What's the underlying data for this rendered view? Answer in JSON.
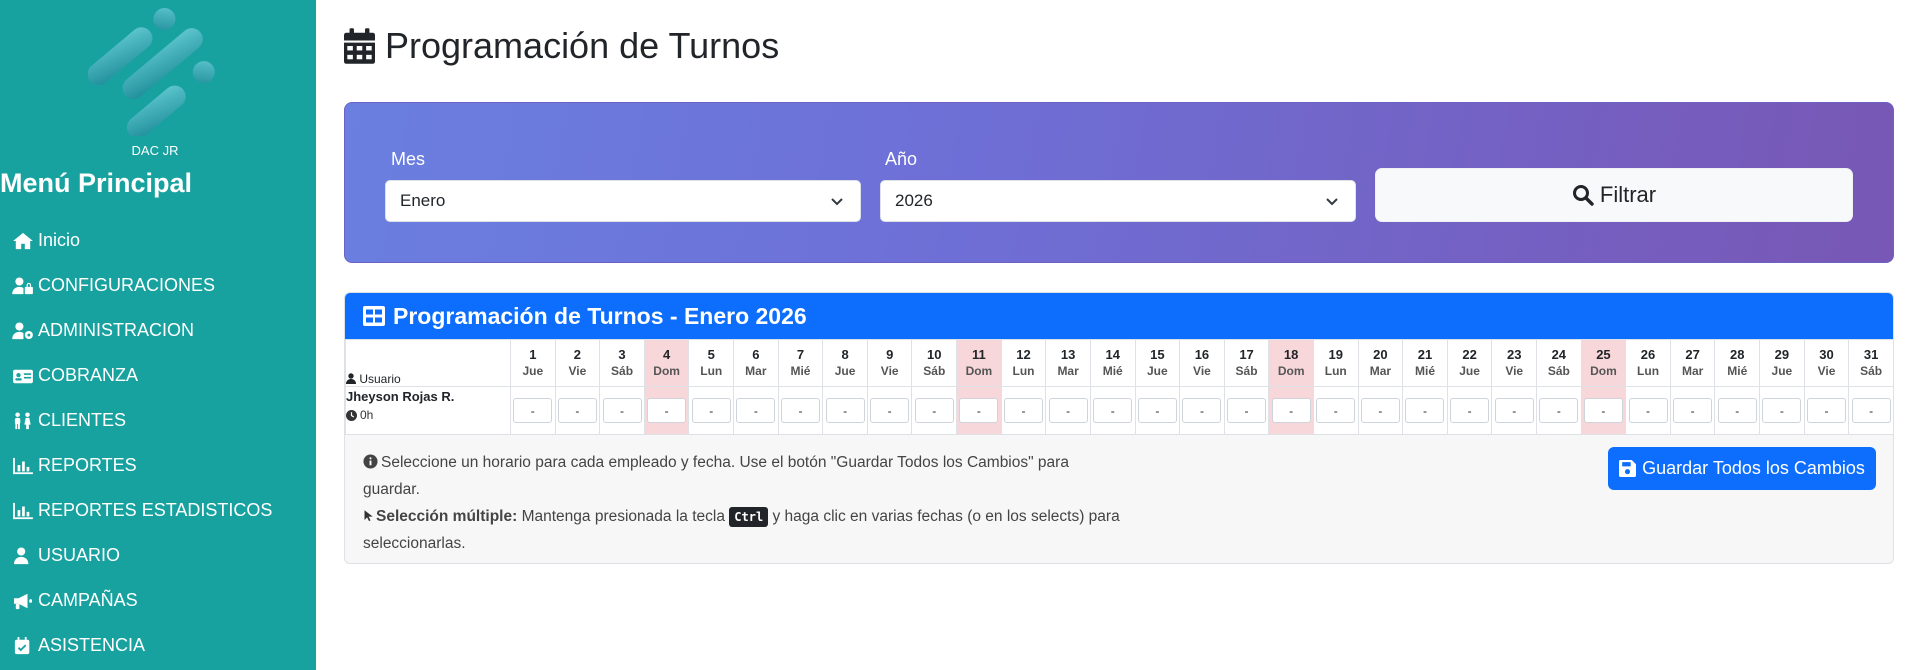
{
  "sidebar": {
    "brand": "DAC JR",
    "menu_title": "Menú Principal",
    "items": [
      {
        "label": "Inicio",
        "icon": "home-icon"
      },
      {
        "label": "CONFIGURACIONES",
        "icon": "user-lock-icon"
      },
      {
        "label": "ADMINISTRACION",
        "icon": "user-gear-icon"
      },
      {
        "label": "COBRANZA",
        "icon": "id-card-icon"
      },
      {
        "label": "CLIENTES",
        "icon": "people-icon"
      },
      {
        "label": "REPORTES",
        "icon": "chart-icon"
      },
      {
        "label": "REPORTES ESTADISTICOS",
        "icon": "chart-icon"
      },
      {
        "label": "USUARIO",
        "icon": "user-icon"
      },
      {
        "label": "CAMPAÑAS",
        "icon": "megaphone-icon"
      },
      {
        "label": "ASISTENCIA",
        "icon": "calendar-check-icon"
      }
    ]
  },
  "page": {
    "title": "Programación de Turnos"
  },
  "filter": {
    "month_label": "Mes",
    "month_value": "Enero",
    "year_label": "Año",
    "year_value": "2026",
    "button_label": "Filtrar"
  },
  "schedule": {
    "title": "Programación de Turnos - Enero 2026",
    "user_header": "Usuario",
    "days": [
      {
        "num": "1",
        "dow": "Jue"
      },
      {
        "num": "2",
        "dow": "Vie"
      },
      {
        "num": "3",
        "dow": "Sáb"
      },
      {
        "num": "4",
        "dow": "Dom"
      },
      {
        "num": "5",
        "dow": "Lun"
      },
      {
        "num": "6",
        "dow": "Mar"
      },
      {
        "num": "7",
        "dow": "Mié"
      },
      {
        "num": "8",
        "dow": "Jue"
      },
      {
        "num": "9",
        "dow": "Vie"
      },
      {
        "num": "10",
        "dow": "Sáb"
      },
      {
        "num": "11",
        "dow": "Dom"
      },
      {
        "num": "12",
        "dow": "Lun"
      },
      {
        "num": "13",
        "dow": "Mar"
      },
      {
        "num": "14",
        "dow": "Mié"
      },
      {
        "num": "15",
        "dow": "Jue"
      },
      {
        "num": "16",
        "dow": "Vie"
      },
      {
        "num": "17",
        "dow": "Sáb"
      },
      {
        "num": "18",
        "dow": "Dom"
      },
      {
        "num": "19",
        "dow": "Lun"
      },
      {
        "num": "20",
        "dow": "Mar"
      },
      {
        "num": "21",
        "dow": "Mié"
      },
      {
        "num": "22",
        "dow": "Jue"
      },
      {
        "num": "23",
        "dow": "Vie"
      },
      {
        "num": "24",
        "dow": "Sáb"
      },
      {
        "num": "25",
        "dow": "Dom"
      },
      {
        "num": "26",
        "dow": "Lun"
      },
      {
        "num": "27",
        "dow": "Mar"
      },
      {
        "num": "28",
        "dow": "Mié"
      },
      {
        "num": "29",
        "dow": "Jue"
      },
      {
        "num": "30",
        "dow": "Vie"
      },
      {
        "num": "31",
        "dow": "Sáb"
      }
    ],
    "rows": [
      {
        "user": "Jheyson Rojas R.",
        "hours": "0h",
        "cell_value": "-"
      }
    ]
  },
  "info": {
    "line1": "Seleccione un horario para cada empleado y fecha. Use el botón \"Guardar Todos los Cambios\" para guardar.",
    "multi_bold": "Selección múltiple:",
    "multi_text1": "Mantenga presionada la tecla",
    "kbd": "Ctrl",
    "multi_text2": "y haga clic en varias fechas (o en los selects) para seleccionarlas.",
    "save_button": "Guardar Todos los Cambios"
  },
  "colors": {
    "sidebar": "#17a2a0",
    "primary": "#0d6efd",
    "sunday": "#f8d7da",
    "gradient_start": "#6a7fe0",
    "gradient_end": "#7857b5"
  }
}
